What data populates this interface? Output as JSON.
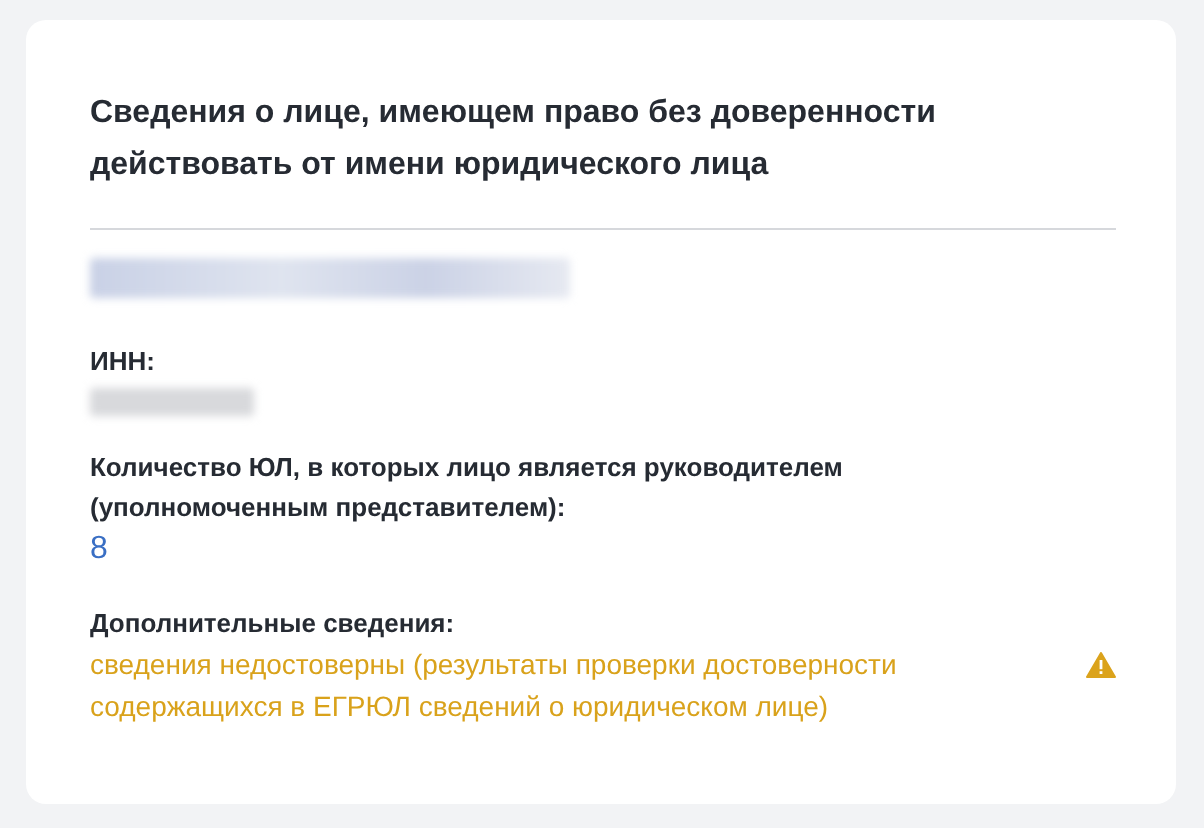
{
  "card": {
    "title": "Сведения о лице, имеющем право без доверенности действовать от имени юридического лица",
    "person": {
      "redacted": true
    },
    "fields": [
      {
        "label": "ИНН:",
        "kind": "redacted"
      },
      {
        "label": "Количество ЮЛ, в которых лицо является руководителем (уполномоченным представителем):",
        "kind": "number",
        "value": "8"
      },
      {
        "label": "Дополнительные сведения:",
        "kind": "warning",
        "value": "сведения недостоверны (результаты проверки достоверности содержащихся в ЕГРЮЛ сведений о юридическом лице)"
      }
    ]
  }
}
